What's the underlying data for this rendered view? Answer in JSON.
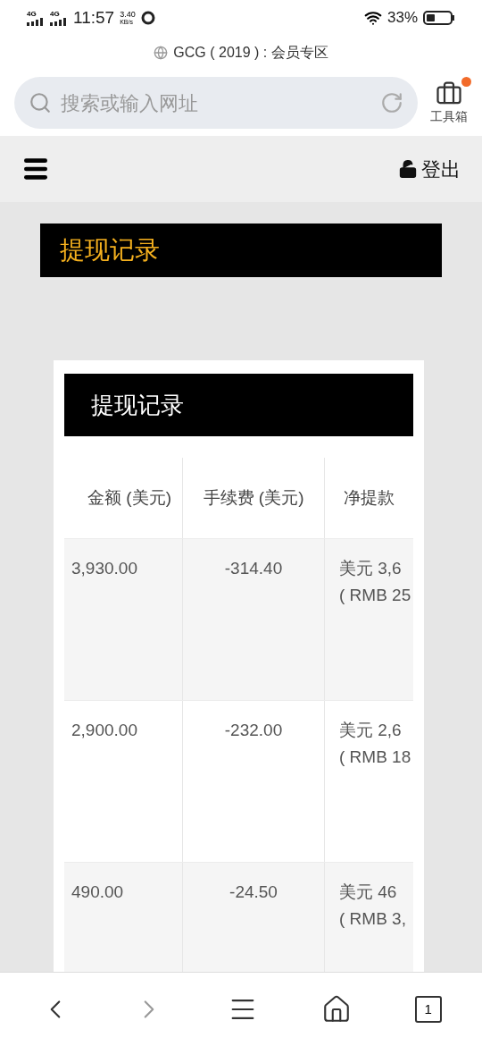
{
  "status_bar": {
    "signal_1": "4G",
    "signal_2": "4G",
    "time": "11:57",
    "speed": "3.40",
    "speed_unit": "KB/s",
    "battery": "33%"
  },
  "browser": {
    "page_title": "GCG ( 2019 ) : 会员专区",
    "search": {
      "placeholder": "搜索或输入网址"
    },
    "toolbox": {
      "label": "工具箱",
      "badge": true
    }
  },
  "site_header": {
    "logout": "登出"
  },
  "banner": {
    "title": "提现记录"
  },
  "card": {
    "title": "提现记录",
    "table": {
      "columns": [
        "金额 (美元)",
        "手续费 (美元)",
        "净提款"
      ],
      "rows": [
        {
          "cells": [
            "3,930.00",
            "-314.40",
            "美元 3,6\n( RMB 25"
          ]
        },
        {
          "cells": [
            "2,900.00",
            "-232.00",
            "美元 2,6\n( RMB 18"
          ]
        },
        {
          "cells": [
            "490.00",
            "-24.50",
            "美元 46\n( RMB 3,"
          ]
        }
      ]
    }
  },
  "bottom_nav": {
    "tab_count": "1"
  }
}
